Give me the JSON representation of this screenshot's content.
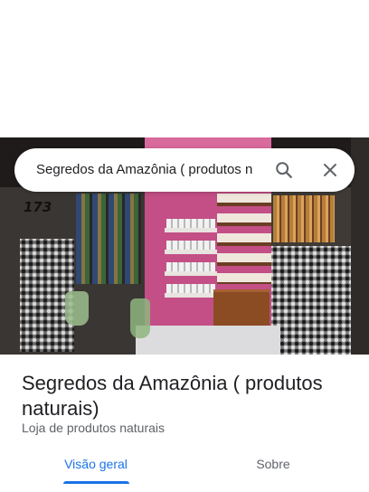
{
  "search": {
    "query": "Segredos da Amazônia ( produtos n",
    "search_icon": "search-icon",
    "close_icon": "close-icon"
  },
  "photo": {
    "storefront_number": "173"
  },
  "place": {
    "title": "Segredos da Amazônia ( produtos naturais)",
    "category": "Loja de produtos naturais"
  },
  "tabs": [
    {
      "label": "Visão geral",
      "active": true
    },
    {
      "label": "Sobre",
      "active": false
    }
  ],
  "colors": {
    "accent": "#1a73e8",
    "text_primary": "#202124",
    "text_secondary": "#5f6368"
  }
}
